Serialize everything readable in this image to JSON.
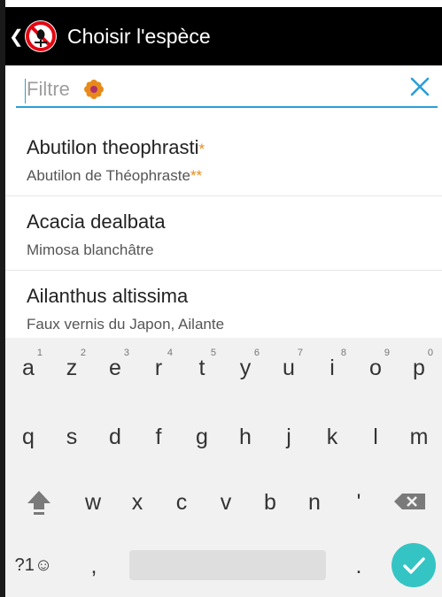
{
  "app_bar": {
    "back_glyph": "❮",
    "title": "Choisir l'espèce",
    "logo": "no-invasive-plant-logo-icon"
  },
  "filter": {
    "placeholder": "Filtre",
    "clear": "close-icon",
    "flower": "flower-icon",
    "accent": "#2a9fd6"
  },
  "species": [
    {
      "latin": "Abutilon theophrasti",
      "latin_mark": "*",
      "common": "Abutilon de Théophraste",
      "common_mark": "**"
    },
    {
      "latin": "Acacia dealbata",
      "latin_mark": "",
      "common": "Mimosa blanchâtre",
      "common_mark": ""
    },
    {
      "latin": "Ailanthus altissima",
      "latin_mark": "",
      "common": "Faux vernis du Japon, Ailante",
      "common_mark": ""
    }
  ],
  "keyboard": {
    "row1": [
      {
        "k": "a",
        "h": "1"
      },
      {
        "k": "z",
        "h": "2"
      },
      {
        "k": "e",
        "h": "3"
      },
      {
        "k": "r",
        "h": "4"
      },
      {
        "k": "t",
        "h": "5"
      },
      {
        "k": "y",
        "h": "6"
      },
      {
        "k": "u",
        "h": "7"
      },
      {
        "k": "i",
        "h": "8"
      },
      {
        "k": "o",
        "h": "9"
      },
      {
        "k": "p",
        "h": "0"
      }
    ],
    "row2": [
      "q",
      "s",
      "d",
      "f",
      "g",
      "h",
      "j",
      "k",
      "l",
      "m"
    ],
    "row3": [
      "w",
      "x",
      "c",
      "v",
      "b",
      "n",
      "'"
    ],
    "symbols": "?1☺",
    "comma": ",",
    "period": ".",
    "shift": "shift-icon",
    "backspace": "backspace-icon",
    "done": "check-icon",
    "done_color": "#35c4c4"
  }
}
